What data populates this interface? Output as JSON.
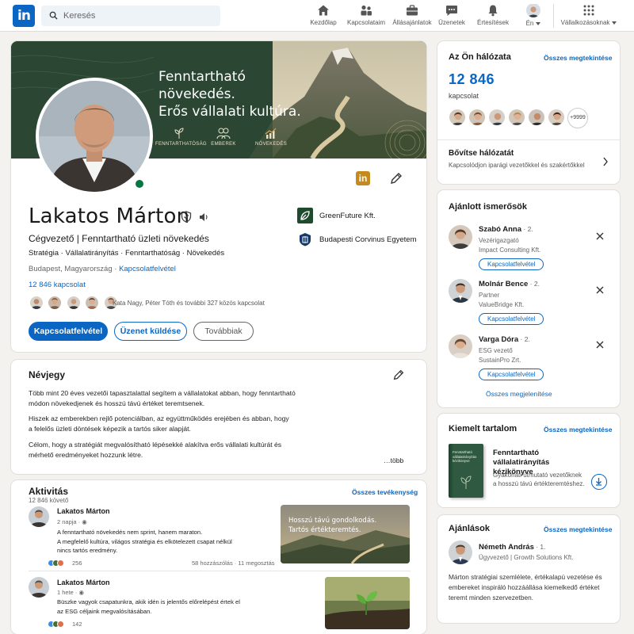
{
  "nav": {
    "search_placeholder": "Keresés",
    "items": [
      {
        "label": "Kezdőlap",
        "icon": "home-icon"
      },
      {
        "label": "Kapcsolataim",
        "icon": "network-icon"
      },
      {
        "label": "Állásajánlatok",
        "icon": "jobs-icon"
      },
      {
        "label": "Üzenetek",
        "icon": "messaging-icon"
      },
      {
        "label": "Értesítések",
        "icon": "bell-icon"
      },
      {
        "label": "Én",
        "icon": "profile-avatar"
      },
      {
        "label": "Vállalkozásoknak",
        "icon": "grid-icon"
      }
    ]
  },
  "banner": {
    "headline_lines": [
      "Fenntartható",
      "növekedés.",
      "Erős vállalati kultúra."
    ],
    "pillars": [
      "FENNTARTHATÓSÁG",
      "EMBEREK",
      "NÖVEKEDÉS"
    ]
  },
  "profile": {
    "name": "Lakatos Márton",
    "headline": "Cégvezető | Fenntartható üzleti növekedés",
    "tags": "Stratégia · Vállalatirányítás · Fenntarthatóság · Növekedés",
    "location": "Budapest, Magyarország · ",
    "contact_link": "Kapcsolatfelvétel",
    "connections": "12 846 kapcsolat",
    "mutual": "Kata Nagy, Péter Tóth és további 327 közös kapcsolat",
    "buttons": {
      "connect": "Kapcsolatfelvétel",
      "message": "Üzenet küldése",
      "more": "Továbbiak"
    },
    "orgs": [
      {
        "name": "GreenFuture Kft.",
        "icon": "greenfuture-logo"
      },
      {
        "name": "Budapesti Corvinus Egyetem",
        "icon": "corvinus-logo"
      }
    ]
  },
  "about": {
    "title": "Névjegy",
    "paragraphs": [
      "Több mint 20 éves vezetői tapasztalattal segítem a vállalatokat abban, hogy fenntartható módon növekedjenek és hosszú távú értéket teremtsenek.",
      "Hiszek az emberekben rejlő potenciálban, az együttműködés erejében és abban, hogy a felelős üzleti döntések képezik a tartós siker alapját.",
      "Célom, hogy a stratégiát megvalósítható lépésekké alakítva erős vállalati kultúrát és mérhető eredményeket hozzunk létre."
    ],
    "more": "…több"
  },
  "activity": {
    "title": "Aktivitás",
    "followers": "12 846 követő",
    "all_link": "Összes tevékenység",
    "posts": [
      {
        "author": "Lakatos Márton",
        "time": "2 napja · ",
        "lines": [
          "A fenntartható növekedés nem sprint, hanem maraton.",
          "A megfelelő kultúra, világos stratégia és elkötelezett csapat nélkül",
          "nincs tartós eredmény."
        ],
        "reactions": "256",
        "stats": "58 hozzászólás · 11 megosztás",
        "image_text": [
          "Hosszú távú gondolkodás.",
          "Tartós értékteremtés."
        ]
      },
      {
        "author": "Lakatos Márton",
        "time": "1 hete · ",
        "lines": [
          "Büszke vagyok csapatunkra, akik idén is jelentős előrelépést értek el",
          "az ESG céljaink megvalósításában."
        ],
        "reactions": "142",
        "stats": "",
        "image_text": []
      }
    ]
  },
  "network": {
    "title": "Az Ön hálózata",
    "all_link": "Összes megtekintése",
    "count": "12 846",
    "count_label": "kapcsolat",
    "more_badge": "+9999",
    "expand_title": "Bővítse hálózatát",
    "expand_sub": "Kapcsolódjon iparági vezetőkkel és szakértőkkel"
  },
  "suggested": {
    "title": "Ajánlott ismerősök",
    "people": [
      {
        "name": "Szabó Anna",
        "degree": " · 2.",
        "role": "Vezérigazgató",
        "company": "Impact Consulting Kft.",
        "action": "Kapcsolatfelvétel"
      },
      {
        "name": "Molnár Bence",
        "degree": " · 2.",
        "role": "Partner",
        "company": "ValueBridge Kft.",
        "action": "Kapcsolatfelvétel"
      },
      {
        "name": "Varga Dóra",
        "degree": " · 2.",
        "role": "ESG vezető",
        "company": "SustainPro Zrt.",
        "action": "Kapcsolatfelvétel"
      }
    ],
    "show_all": "Összes megjelenítése"
  },
  "featured": {
    "title": "Kiemelt tartalom",
    "all_link": "Összes megtekintése",
    "book_cover": "Fenntartható vállalatirányítás kézikönyve",
    "item_title": "Fenntartható vállalatirányítás kézikönyve",
    "item_desc": [
      "Gyakorlati útmutató vezetőknek",
      "a hosszú távú értékteremtéshez."
    ]
  },
  "recommendations": {
    "title": "Ajánlások",
    "all_link": "Összes megtekintése",
    "name": "Németh András",
    "degree": " · 1.",
    "role": "Ügyvezető | Growth Solutions Kft.",
    "text": "Márton stratégiai szemlélete, értékalapú vezetése és embereket inspiráló hozzáállása kiemelkedő értéket teremt minden szervezetben."
  },
  "colors": {
    "brand": "#0a66c2",
    "green_banner": "#2d4a35",
    "online": "#057642"
  }
}
